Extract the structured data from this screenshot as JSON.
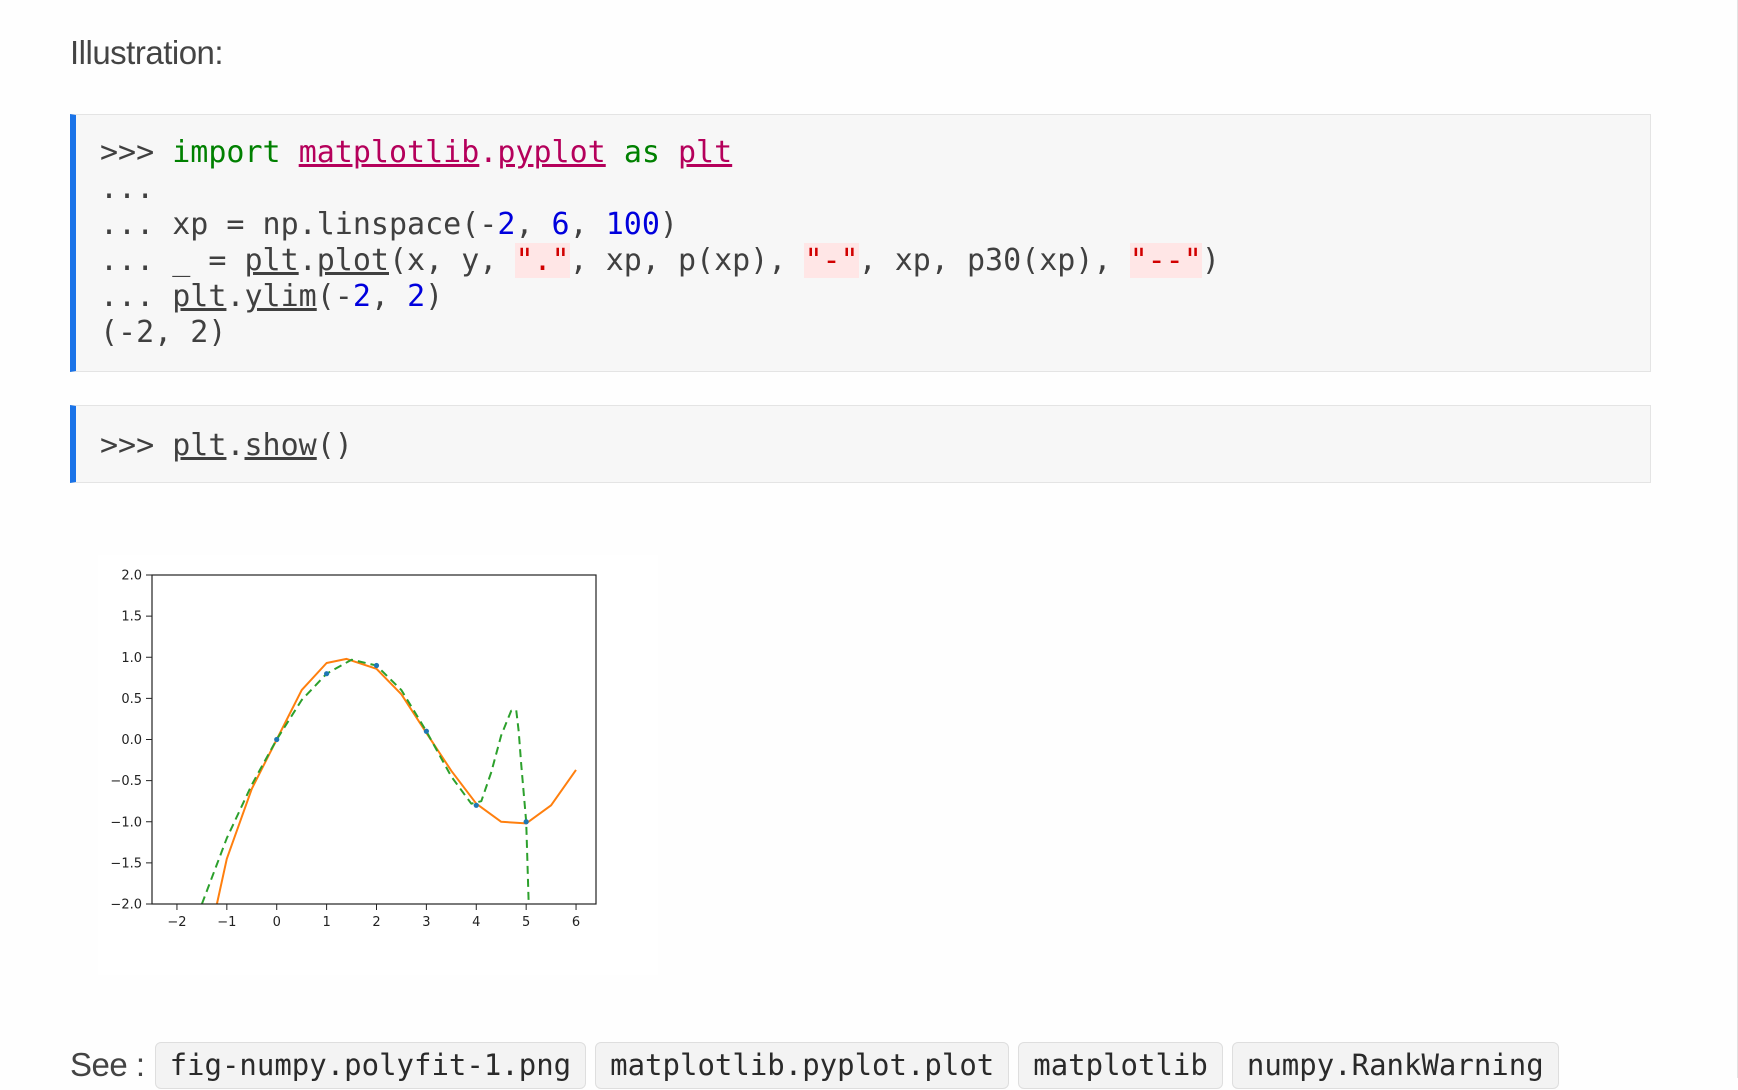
{
  "heading": "Illustration:",
  "code1": {
    "line1": {
      "prompt": ">>> ",
      "kw_import": "import",
      "mod1": "matplotlib",
      "dot": ".",
      "mod2": "pyplot",
      "kw_as": "as",
      "alias": "plt"
    },
    "line2": {
      "text": "..."
    },
    "line3": {
      "prompt": "... ",
      "pre": "xp = np.linspace(-",
      "n1": "2",
      "sep1": ", ",
      "n2": "6",
      "sep2": ", ",
      "n3": "100",
      "post": ")"
    },
    "line4": {
      "prompt": "... ",
      "pre": "_ = ",
      "fn_obj": "plt",
      "dot": ".",
      "fn_name": "plot",
      "a1": "(x, y, ",
      "s1": "\".\"",
      "a2": ", xp, p(xp), ",
      "s2": "\"-\"",
      "a3": ", xp, p30(xp), ",
      "s3": "\"--\"",
      "a4": ")"
    },
    "line5": {
      "prompt": "... ",
      "fn_obj": "plt",
      "dot": ".",
      "fn_name": "ylim",
      "a1": "(-",
      "n1": "2",
      "a2": ", ",
      "n2": "2",
      "a3": ")"
    },
    "line6": {
      "text": "(-2, 2)"
    }
  },
  "code2": {
    "prompt": ">>> ",
    "fn_obj": "plt",
    "dot": ".",
    "fn_name": "show",
    "tail": "()"
  },
  "chart_data": {
    "type": "line",
    "xlim": [
      -2.5,
      6.4
    ],
    "ylim": [
      -2,
      2
    ],
    "xticks": [
      "−2",
      "−1",
      "0",
      "1",
      "2",
      "3",
      "4",
      "5",
      "6"
    ],
    "yticks": [
      "−2.0",
      "−1.5",
      "−1.0",
      "−0.5",
      "0.0",
      "0.5",
      "1.0",
      "1.5",
      "2.0"
    ],
    "colors": {
      "points": "#1f77b4",
      "fit3": "#ff7f0e",
      "fit30": "#2ca02c"
    },
    "points": {
      "x": [
        0,
        1,
        2,
        3,
        4,
        5
      ],
      "y": [
        0.0,
        0.8,
        0.9,
        0.1,
        -0.8,
        -1.0
      ]
    },
    "fit3": {
      "x": [
        -1.2,
        -1.0,
        -0.5,
        0,
        0.5,
        1.0,
        1.4,
        2.0,
        2.5,
        3.0,
        3.5,
        4.0,
        4.5,
        5.0,
        5.5,
        6.0
      ],
      "y": [
        -2.0,
        -1.45,
        -0.6,
        0.0,
        0.6,
        0.93,
        0.98,
        0.86,
        0.55,
        0.08,
        -0.38,
        -0.78,
        -1.0,
        -1.02,
        -0.8,
        -0.37
      ]
    },
    "fit30": {
      "x": [
        -1.5,
        -1.0,
        -0.5,
        0,
        0.5,
        1.0,
        1.5,
        2.0,
        2.5,
        3.0,
        3.5,
        3.9,
        4.1,
        4.3,
        4.5,
        4.7,
        4.8,
        4.85,
        4.9,
        5.0,
        5.05
      ],
      "y": [
        -2.0,
        -1.2,
        -0.55,
        0.0,
        0.48,
        0.8,
        0.97,
        0.9,
        0.6,
        0.1,
        -0.45,
        -0.78,
        -0.75,
        -0.4,
        0.05,
        0.35,
        0.36,
        0.1,
        -0.3,
        -1.0,
        -2.0
      ]
    }
  },
  "see": {
    "label": "See :",
    "tags": [
      "fig-numpy.polyfit-1.png",
      "matplotlib.pyplot.plot",
      "matplotlib",
      "numpy.RankWarning"
    ]
  }
}
